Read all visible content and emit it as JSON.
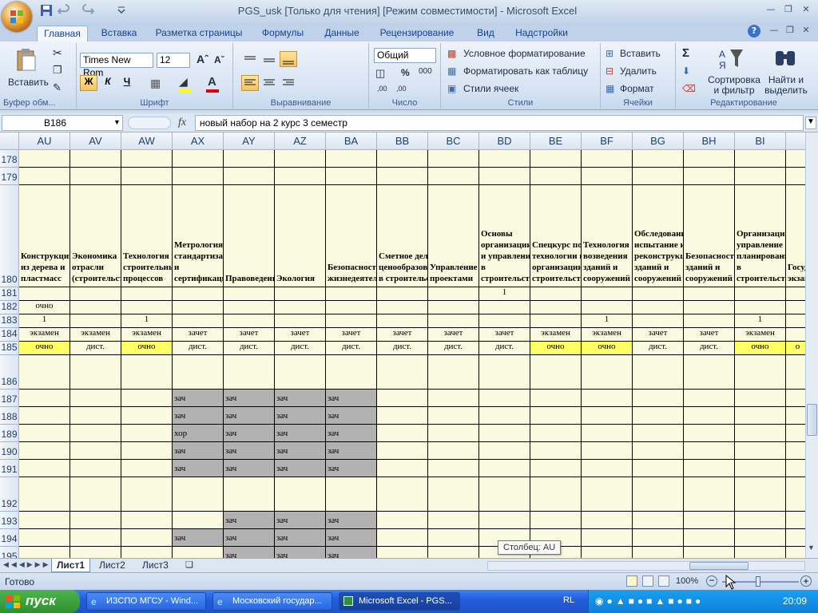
{
  "window": {
    "title": "PGS_usk  [Только для чтения]  [Режим совместимости] - Microsoft Excel"
  },
  "ribbon_tabs": [
    "Главная",
    "Вставка",
    "Разметка страницы",
    "Формулы",
    "Данные",
    "Рецензирование",
    "Вид",
    "Надстройки"
  ],
  "ribbon": {
    "clipboard": {
      "label": "Буфер обм...",
      "paste": "Вставить"
    },
    "font": {
      "label": "Шрифт",
      "name": "Times New Rom",
      "size": "12",
      "bold": "Ж",
      "italic": "К",
      "underline": "Ч"
    },
    "alignment": {
      "label": "Выравнивание"
    },
    "number": {
      "label": "Число",
      "format": "Общий"
    },
    "styles": {
      "label": "Стили",
      "conditional": "Условное форматирование",
      "as_table": "Форматировать как таблицу",
      "cell_styles": "Стили ячеек"
    },
    "cells": {
      "label": "Ячейки",
      "insert": "Вставить",
      "delete": "Удалить",
      "format": "Формат"
    },
    "editing": {
      "label": "Редактирование",
      "sort": "Сортировка и фильтр",
      "find": "Найти и выделить"
    }
  },
  "formula_bar": {
    "name_box": "B186",
    "fx": "fx",
    "formula": "новый набор на 2 курс 3 семестр"
  },
  "grid": {
    "columns": [
      "AU",
      "AV",
      "AW",
      "AX",
      "AY",
      "AZ",
      "BA",
      "BB",
      "BC",
      "BD",
      "BE",
      "BF",
      "BG",
      "BH",
      "BI"
    ],
    "row_numbers": [
      "178",
      "179",
      "180",
      "181",
      "182",
      "183",
      "184",
      "185",
      "186",
      "187",
      "188",
      "189",
      "190",
      "191",
      "192",
      "193",
      "194",
      "195"
    ],
    "headers_180": [
      "Конструкции из дерева и пластмасс",
      "Экономика отрасли (строительства)",
      "Технология строительных процессов",
      "Метрология, стандартизация и сертификация",
      "Правоведение",
      "Экология",
      "Безопасность жизнедеятельности",
      "Сметное дело и ценообразование в строительства",
      "Управление проектами",
      "Основы организации и управления в строительстве",
      "Спецкурс по технологии и организации строительства",
      "Технология возведения зданий и сооружений",
      "Обследование, испытание и реконструкция зданий и сооружений",
      "Безопасность зданий и сооружений",
      "Организация, управление и планирование в строительстве",
      "Государственный экзамен"
    ],
    "row181": {
      "BD": "1"
    },
    "row182": {
      "AU": "очно"
    },
    "row183": {
      "AU": "1",
      "AW": "1",
      "BF": "1",
      "BI": "1"
    },
    "row184": [
      "экзамен",
      "экзамен",
      "экзамен",
      "зачет",
      "зачет",
      "зачет",
      "зачет",
      "зачет",
      "зачет",
      "зачет",
      "экзамен",
      "экзамен",
      "зачет",
      "зачет",
      "экзамен"
    ],
    "row185": [
      "очно",
      "дист.",
      "очно",
      "дист.",
      "дист.",
      "дист.",
      "дист.",
      "дист.",
      "дист.",
      "дист.",
      "очно",
      "очно",
      "дист.",
      "дист.",
      "очно",
      "о"
    ],
    "grades": {
      "187": [
        "зач",
        "зач",
        "зач",
        "зач"
      ],
      "188": [
        "зач",
        "зач",
        "зач",
        "зач"
      ],
      "189": [
        "хор",
        "зач",
        "зач",
        "зач"
      ],
      "190": [
        "зач",
        "зач",
        "зач",
        "зач"
      ],
      "191": [
        "зач",
        "зач",
        "зач",
        "зач"
      ],
      "193": [
        "",
        "зач",
        "зач",
        "зач"
      ],
      "194": [
        "зач",
        "зач",
        "зач",
        "зач"
      ],
      "195": [
        "",
        "зач",
        "зач",
        "зач"
      ]
    }
  },
  "sheet_tabs": [
    "Лист1",
    "Лист2",
    "Лист3"
  ],
  "tooltip": "Столбец: AU",
  "status": {
    "ready": "Готово",
    "zoom": "100%"
  },
  "taskbar": {
    "start": "пуск",
    "tasks": [
      "ИЗСПО МГСУ - Wind...",
      "Московский государ...",
      "Microsoft Excel - PGS..."
    ],
    "lang": "RL",
    "clock": "20:09"
  }
}
